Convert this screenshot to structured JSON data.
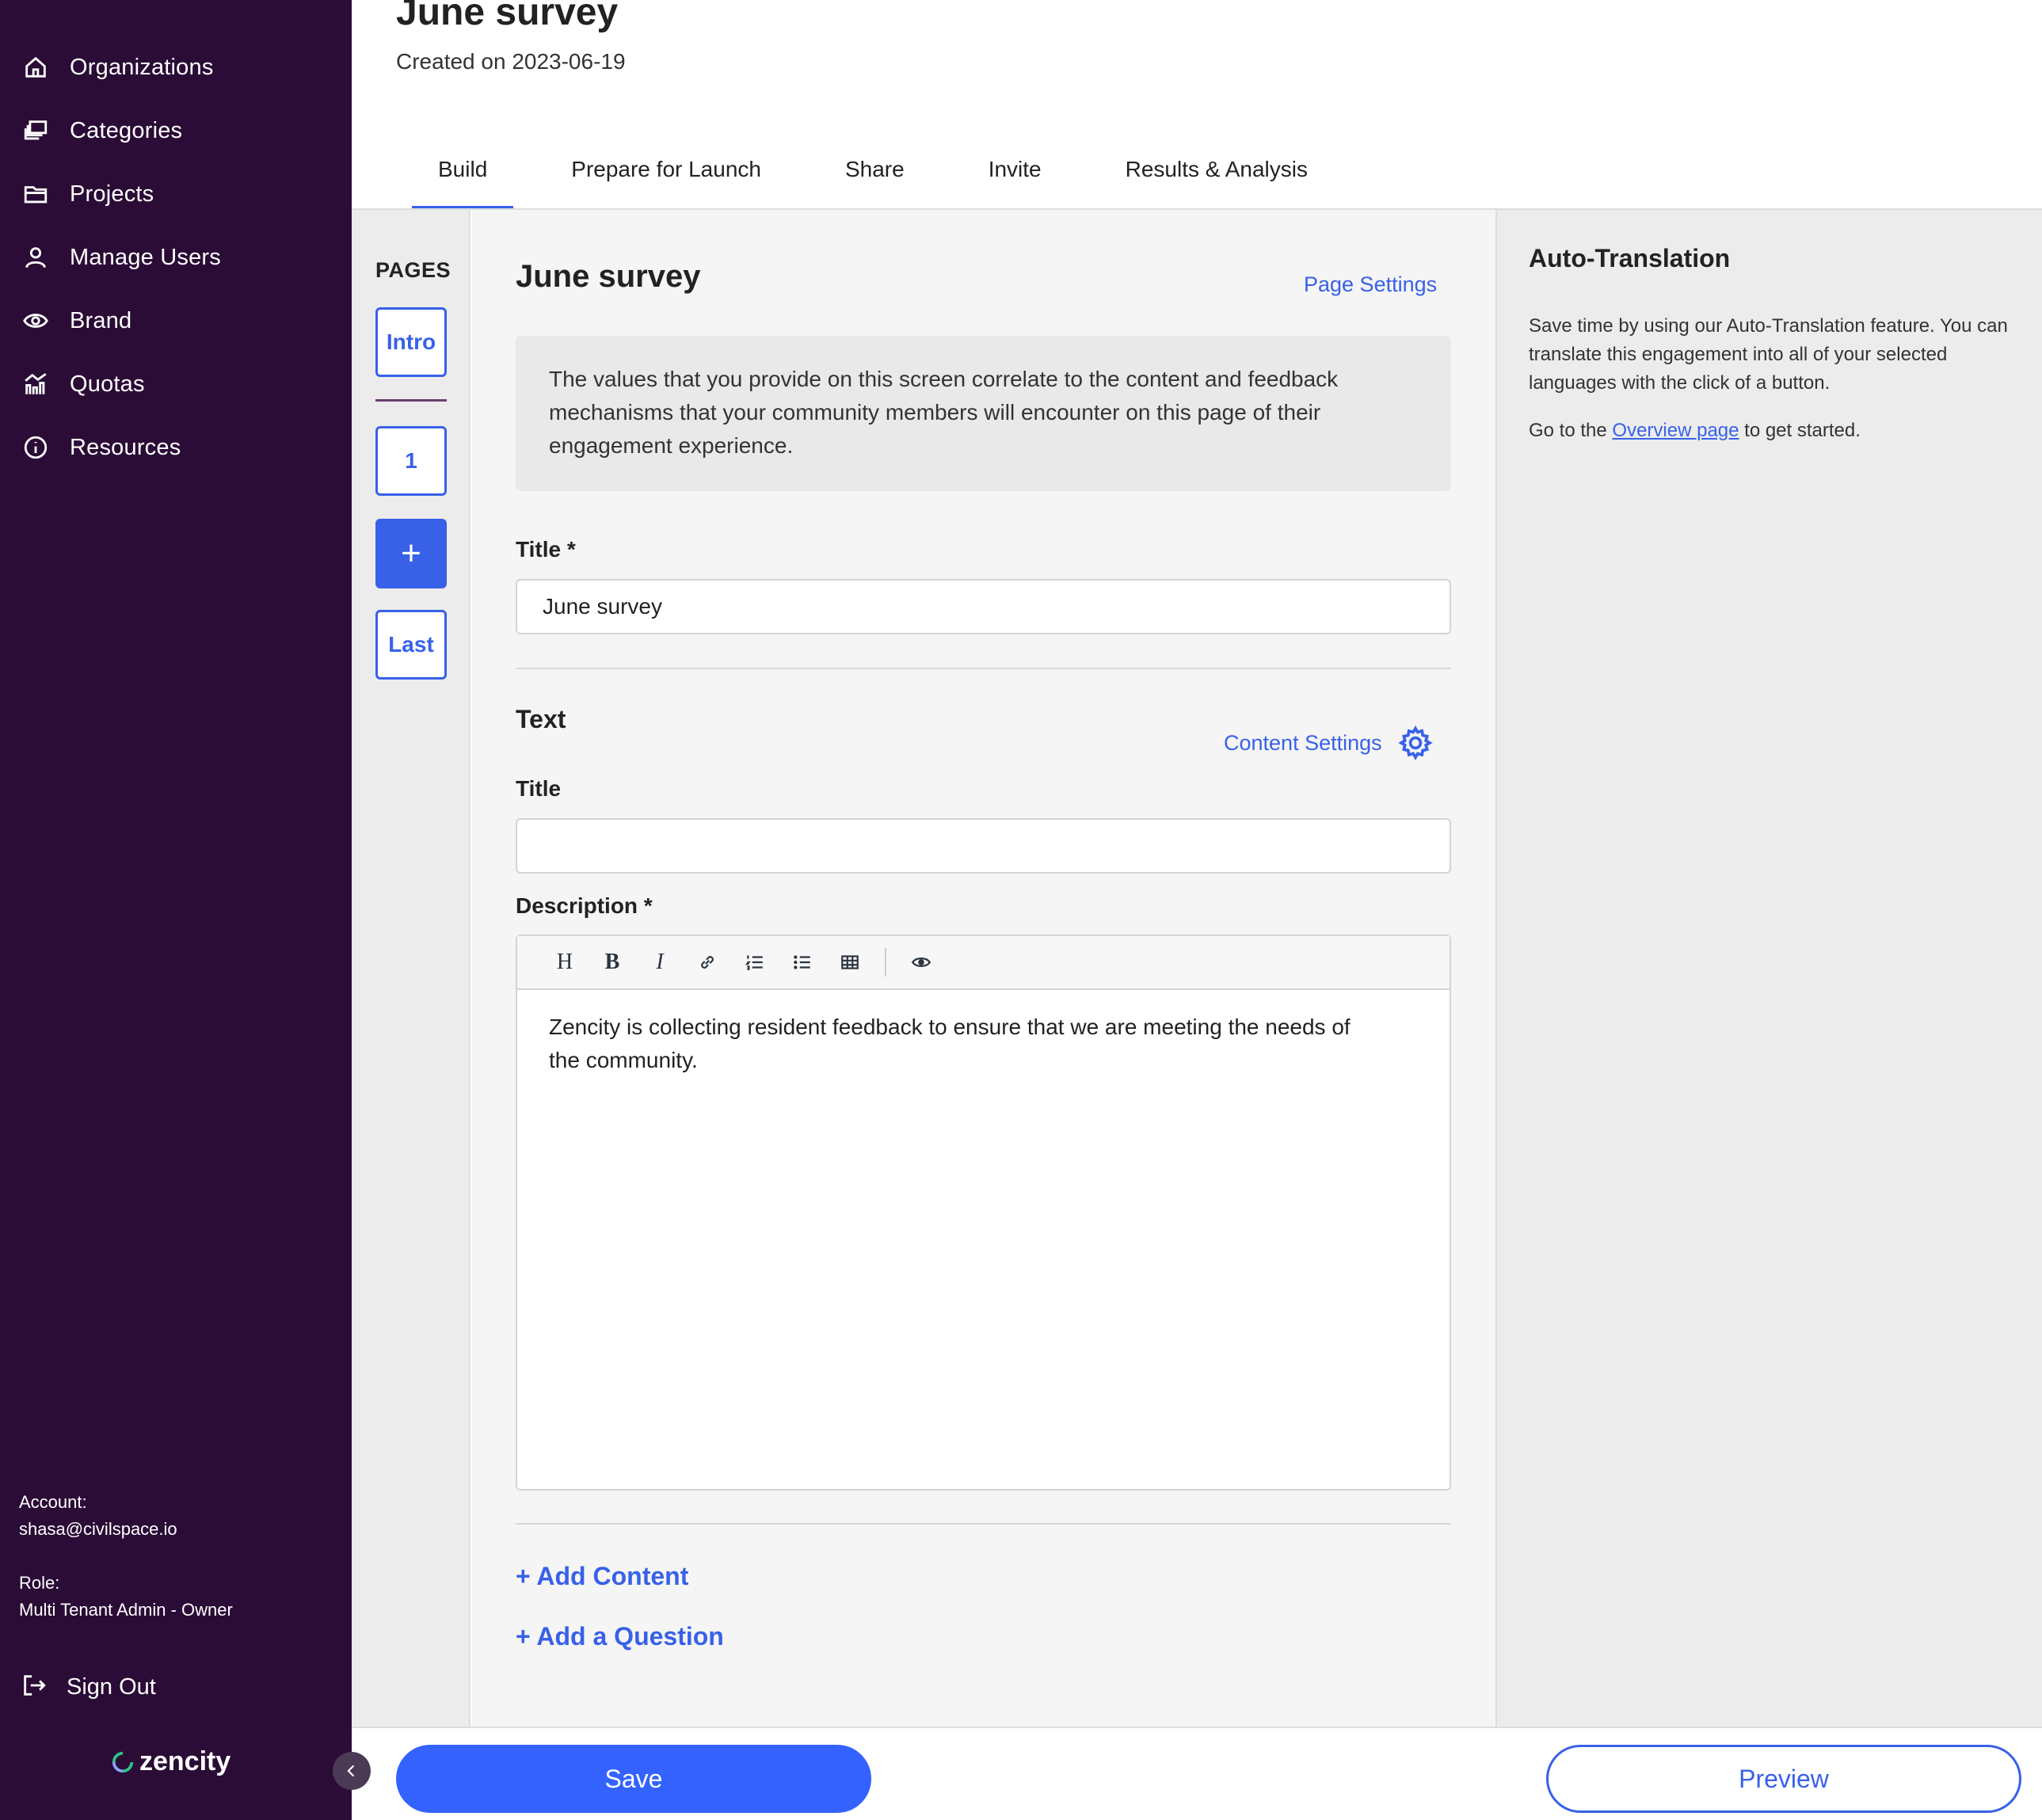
{
  "sidebar": {
    "items": [
      {
        "label": "Organizations",
        "icon": "home-icon"
      },
      {
        "label": "Categories",
        "icon": "layers-icon"
      },
      {
        "label": "Projects",
        "icon": "folder-icon"
      },
      {
        "label": "Manage Users",
        "icon": "user-icon"
      },
      {
        "label": "Brand",
        "icon": "eye-icon"
      },
      {
        "label": "Quotas",
        "icon": "chart-icon"
      },
      {
        "label": "Resources",
        "icon": "info-icon"
      }
    ],
    "account_label": "Account:",
    "account_value": "shasa@civilspace.io",
    "role_label": "Role:",
    "role_value": "Multi Tenant Admin - Owner",
    "sign_out": "Sign Out",
    "logo_text": "zencity"
  },
  "header": {
    "title": "June survey",
    "subtitle": "Created on 2023-06-19",
    "tabs": [
      {
        "label": "Build",
        "active": true
      },
      {
        "label": "Prepare for Launch",
        "active": false
      },
      {
        "label": "Share",
        "active": false
      },
      {
        "label": "Invite",
        "active": false
      },
      {
        "label": "Results & Analysis",
        "active": false
      }
    ]
  },
  "pages": {
    "label": "PAGES",
    "buttons": [
      "Intro",
      "1",
      "+",
      "Last"
    ]
  },
  "main": {
    "section_title": "June survey",
    "page_settings": "Page Settings",
    "info": "The values that you provide on this screen correlate to the content and feedback mechanisms that your community members will encounter on this page of their engagement experience.",
    "title_label": "Title *",
    "title_value": "June survey",
    "text_heading": "Text",
    "content_settings": "Content Settings",
    "text_title_label": "Title",
    "text_title_value": "",
    "description_label": "Description *",
    "toolbar": [
      "H",
      "B",
      "I",
      "link-icon",
      "ordered-list-icon",
      "bullet-list-icon",
      "table-icon",
      "eye-icon"
    ],
    "description_value": "Zencity  is collecting resident feedback to ensure that we are meeting the needs of the community.",
    "add_content": "+ Add Content",
    "add_question": "+ Add a Question"
  },
  "auto_translation": {
    "title": "Auto-Translation",
    "text": "Save time by using our Auto-Translation feature. You can translate this engagement into all of your selected languages with the click of a button.",
    "go_prefix": "Go to the ",
    "go_link": "Overview page",
    "go_suffix": " to get started."
  },
  "footer": {
    "save": "Save",
    "preview": "Preview"
  },
  "colors": {
    "sidebar_bg": "#2b0c36",
    "accent": "#3861e8",
    "save_button": "#3362ff"
  }
}
